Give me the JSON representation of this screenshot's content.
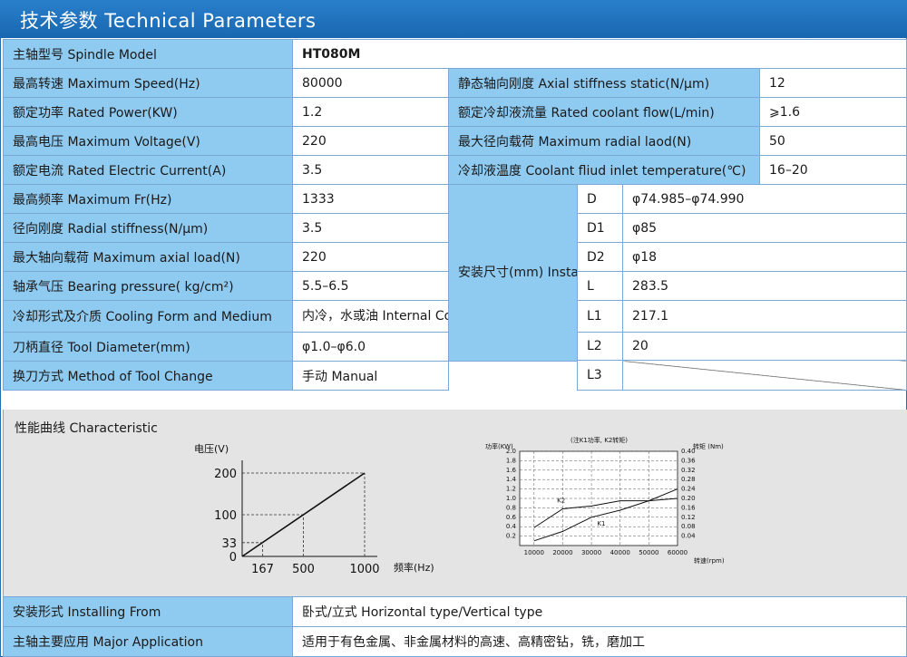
{
  "title": "技术参数 Technical Parameters",
  "rows": [
    {
      "label": "主轴型号 Spindle Model",
      "value": "HT080M"
    },
    {
      "label": "最高转速 Maximum Speed(Hz)",
      "value": "80000",
      "label2": "静态轴向刚度 Axial stiffness static(N/μm)",
      "value2": "12"
    },
    {
      "label": "额定功率 Rated Power(KW)",
      "value": "1.2",
      "label2": "额定冷却液流量 Rated coolant flow(L/min)",
      "value2": "⩾1.6"
    },
    {
      "label": "最高电压 Maximum Voltage(V)",
      "value": "220",
      "label2": "最大径向载荷 Maximum radial laod(N)",
      "value2": "50"
    },
    {
      "label": "额定电流 Rated Electric Current(A)",
      "value": "3.5",
      "label2": "冷却液温度 Coolant fliud inlet temperature(℃)",
      "value2": "16–20"
    },
    {
      "label": "最高频率 Maximum Fr(Hz)",
      "value": "1333"
    },
    {
      "label": "径向刚度 Radial stiffness(N/μm)",
      "value": "3.5"
    },
    {
      "label": "最大轴向载荷 Maximum axial load(N)",
      "value": "220"
    },
    {
      "label": "轴承气压 Bearing pressure( kg/cm²)",
      "value": "5.5–6.5"
    },
    {
      "label": "冷却形式及介质 Cooling Form and Medium",
      "value": "内冷，水或油 Internal Cooling,Water or Oil"
    },
    {
      "label": "刀柄直径 Tool Diameter(mm)",
      "value": "φ1.0–φ6.0"
    },
    {
      "label": "换刀方式 Method of Tool Change",
      "value": "手动 Manual"
    }
  ],
  "installation": {
    "label": "安装尺寸(mm) Installation dimensions",
    "dims": [
      {
        "name": "D",
        "value": "φ74.985–φ74.990"
      },
      {
        "name": "D1",
        "value": "φ85"
      },
      {
        "name": "D2",
        "value": "φ18"
      },
      {
        "name": "L",
        "value": "283.5"
      },
      {
        "name": "L1",
        "value": "217.1"
      },
      {
        "name": "L2",
        "value": "20"
      },
      {
        "name": "L3",
        "value": ""
      }
    ]
  },
  "characteristic": {
    "title": "性能曲线 Characteristic",
    "voltage_chart": {
      "type": "line",
      "ylabel": "电压(V)",
      "xlabel": "频率(Hz)",
      "xticks": [
        "167",
        "500",
        "1000"
      ],
      "yticks": [
        "0",
        "33",
        "100",
        "200"
      ],
      "x": [
        0,
        1000
      ],
      "y": [
        0,
        200
      ],
      "markers": [
        {
          "x": 167,
          "y": 33
        },
        {
          "x": 500,
          "y": 100
        },
        {
          "x": 1000,
          "y": 200
        }
      ]
    },
    "power_torque_chart": {
      "type": "line",
      "legend": "(注K1功率, K2转矩)",
      "left_axis_label": "功率(KW)",
      "right_axis_label": "转矩 (Nm)",
      "xlabel": "转速(rpm)",
      "left_ticks": [
        "0.2",
        "0.4",
        "0.6",
        "0.8",
        "1.0",
        "1.2",
        "1.4",
        "1.6",
        "1.8",
        "2.0"
      ],
      "right_ticks": [
        "0.04",
        "0.08",
        "0.12",
        "0.16",
        "0.20",
        "0.24",
        "0.28",
        "0.32",
        "0.36",
        "0.40"
      ],
      "x_ticks": [
        "10000",
        "20000",
        "30000",
        "40000",
        "50000",
        "60000"
      ],
      "series": [
        {
          "name": "K1",
          "x": [
            10000,
            20000,
            30000,
            40000,
            50000,
            60000
          ],
          "y": [
            0.1,
            0.3,
            0.6,
            0.75,
            0.95,
            1.2
          ]
        },
        {
          "name": "K2",
          "x": [
            10000,
            20000,
            30000,
            40000,
            50000,
            60000
          ],
          "y": [
            0.38,
            0.78,
            0.84,
            0.95,
            0.95,
            1.0
          ]
        }
      ]
    }
  },
  "bottom": [
    {
      "label": "安装形式 Installing From",
      "value": "卧式/立式 Horizontal type/Vertical type"
    },
    {
      "label": "主轴主要应用 Major Application",
      "value": "适用于有色金属、非金属材料的高速、高精密钻，铣，磨加工"
    }
  ],
  "colors": {
    "title_bar": "#1f72bd",
    "label_bg": "#8fcaf0",
    "panel_bg": "#e4e4e4",
    "border": "#7aa9d8"
  }
}
